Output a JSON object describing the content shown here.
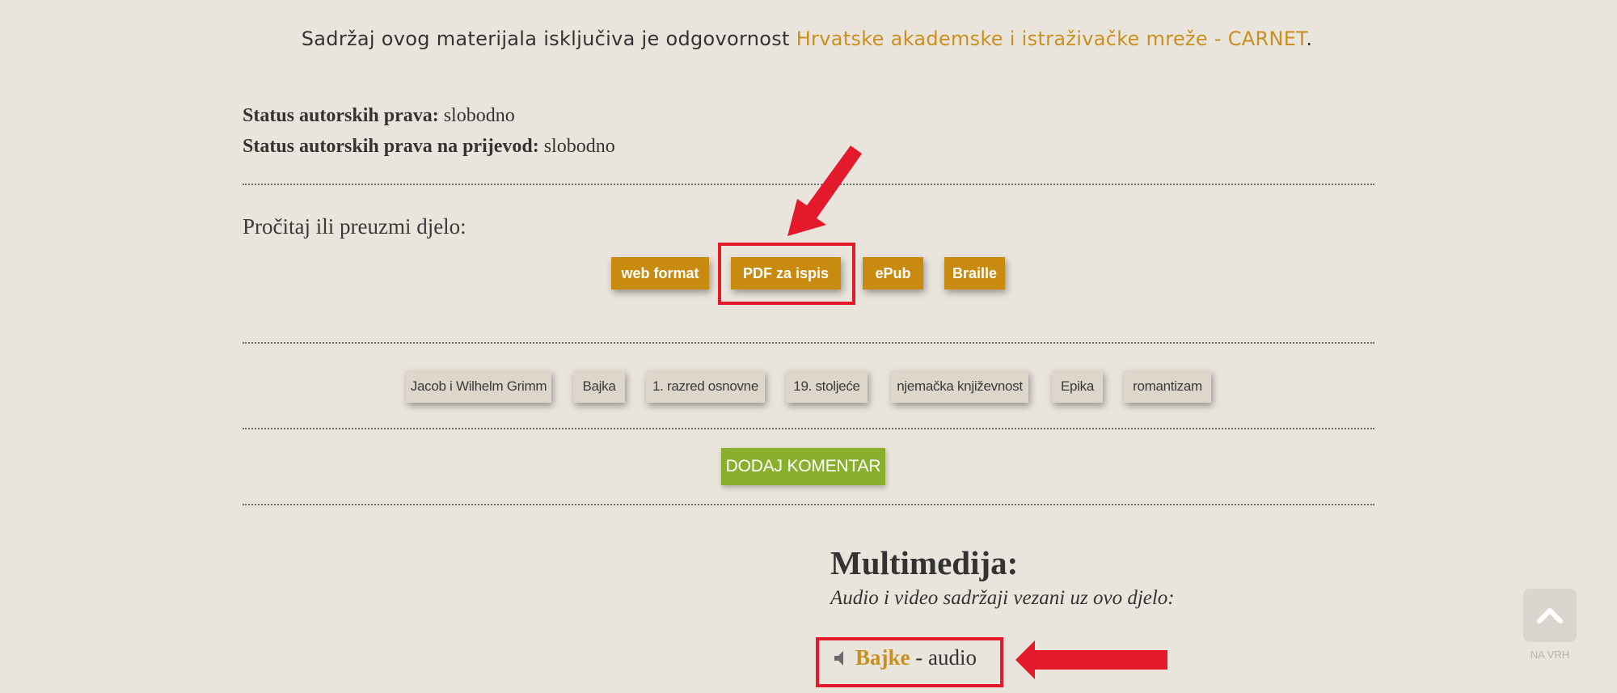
{
  "notice": {
    "text_before": "Sadržaj ovog materijala isključiva je odgovornost ",
    "link": "Hrvatske akademske i istraživačke mreže - CARNET",
    "text_after": "."
  },
  "copyright": {
    "label1": "Status autorskih prava:",
    "value1": "slobodno",
    "label2": "Status autorskih prava na prijevod:",
    "value2": "slobodno"
  },
  "read": {
    "label": "Pročitaj ili preuzmi djelo:",
    "formats": [
      "web format",
      "PDF za ispis",
      "ePub",
      "Braille"
    ]
  },
  "tags": [
    "Jacob i Wilhelm Grimm",
    "Bajka",
    "1. razred osnovne",
    "19. stoljeće",
    "njemačka književnost",
    "Epika",
    "romantizam"
  ],
  "comment_button": "DODAJ KOMENTAR",
  "multimedia": {
    "title": "Multimedija:",
    "subtitle": "Audio i video sadržaji vezani uz ovo djelo:",
    "audio_link": "Bajke",
    "audio_suffix": " - audio"
  },
  "back_to_top": "NA VRH",
  "colors": {
    "background": "#e9e4dc",
    "accent": "#c98a10",
    "link": "#c8901f",
    "comment": "#88b02c",
    "annotation": "#e4192b"
  },
  "icons": [
    "speaker-icon",
    "chevron-up-icon",
    "annotation-arrow"
  ]
}
